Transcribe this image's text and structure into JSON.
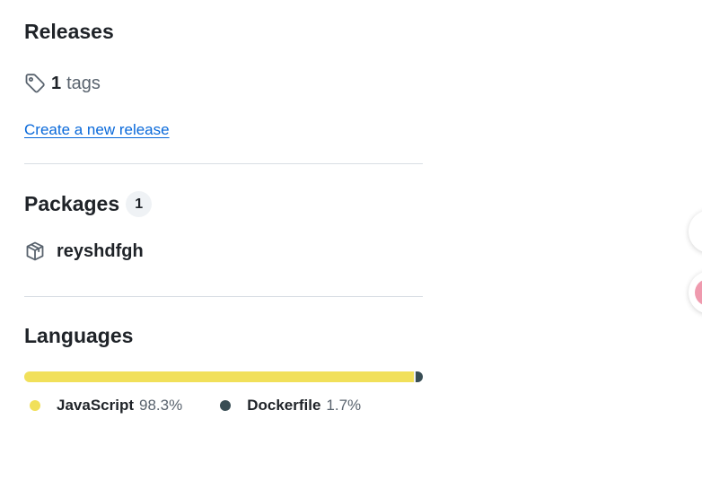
{
  "releases": {
    "title": "Releases",
    "tags_count": "1",
    "tags_label": "tags",
    "create_link": "Create a new release"
  },
  "packages": {
    "title": "Packages",
    "count": "1",
    "items": [
      {
        "name": "reyshdfgh"
      }
    ]
  },
  "languages": {
    "title": "Languages",
    "items": [
      {
        "name": "JavaScript",
        "percent": "98.3%",
        "share": 98.3,
        "color": "#f1e05a"
      },
      {
        "name": "Dockerfile",
        "percent": "1.7%",
        "share": 1.7,
        "color": "#384d54"
      }
    ]
  },
  "floating": {
    "accent_color": "#ef9aae"
  }
}
